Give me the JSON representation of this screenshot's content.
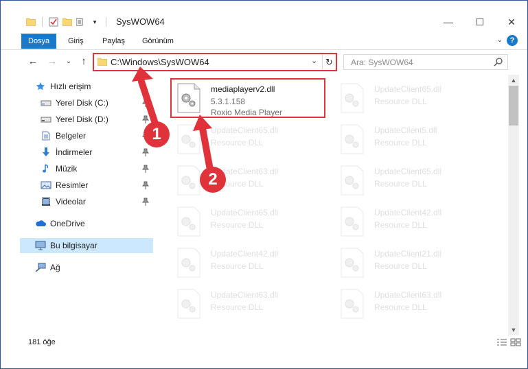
{
  "window": {
    "title": "SysWOW64",
    "controls": {
      "minimize": "—",
      "maximize": "☐",
      "close": "✕"
    }
  },
  "ribbon": {
    "tabs": [
      "Dosya",
      "Giriş",
      "Paylaş",
      "Görünüm"
    ],
    "active_tab": "Dosya",
    "help": "?"
  },
  "navigation": {
    "back": "←",
    "forward": "→",
    "recent": "⌄",
    "up": "↑",
    "address_path": "C:\\Windows\\SysWOW64",
    "refresh": "↻",
    "search_placeholder": "Ara: SysWOW64"
  },
  "sidebar": {
    "items": [
      {
        "label": "Hızlı erişim",
        "icon": "star-icon",
        "pinned": false
      },
      {
        "label": "Yerel Disk (C:)",
        "icon": "drive-icon",
        "pinned": true
      },
      {
        "label": "Yerel Disk (D:)",
        "icon": "drive-icon",
        "pinned": true
      },
      {
        "label": "Belgeler",
        "icon": "documents-icon",
        "pinned": true
      },
      {
        "label": "İndirmeler",
        "icon": "downloads-icon",
        "pinned": true
      },
      {
        "label": "Müzik",
        "icon": "music-icon",
        "pinned": true
      },
      {
        "label": "Resimler",
        "icon": "pictures-icon",
        "pinned": true
      },
      {
        "label": "Videolar",
        "icon": "videos-icon",
        "pinned": true
      },
      {
        "label": "OneDrive",
        "icon": "cloud-icon",
        "pinned": false
      },
      {
        "label": "Bu bilgisayar",
        "icon": "computer-icon",
        "pinned": false
      },
      {
        "label": "Ağ",
        "icon": "network-icon",
        "pinned": false
      }
    ],
    "selected": "Bu bilgisayar"
  },
  "files": {
    "highlighted": {
      "name": "mediaplayerv2.dll",
      "version": "5.3.1.158",
      "description": "Roxio Media Player"
    },
    "left_column": [
      {
        "name": "UpdateClient65.dll",
        "description": "Resource DLL"
      },
      {
        "name": "UpdateClient63.dll",
        "description": "Resource DLL"
      },
      {
        "name": "UpdateClient65.dll",
        "description": "Resource DLL"
      },
      {
        "name": "UpdateClient42.dll",
        "description": "Resource DLL"
      },
      {
        "name": "UpdateClient63.dll",
        "description": "Resource DLL"
      }
    ],
    "right_column": [
      {
        "name": "UpdateClient65.dll",
        "description": "Resource DLL"
      },
      {
        "name": "UpdateClient5.dll",
        "description": "Resource DLL"
      },
      {
        "name": "UpdateClient65.dll",
        "description": "Resource DLL"
      },
      {
        "name": "UpdateClient42.dll",
        "description": "Resource DLL"
      },
      {
        "name": "UpdateClient21.dll",
        "description": "Resource DLL"
      },
      {
        "name": "UpdateClient63.dll",
        "description": "Resource DLL"
      }
    ]
  },
  "status": {
    "item_count": "181 öğe"
  },
  "annotations": {
    "step1": "1",
    "step2": "2",
    "color": "#e0323a"
  },
  "colors": {
    "accent": "#1979ca",
    "selection": "#cce8ff",
    "annotation": "#e0323a"
  }
}
